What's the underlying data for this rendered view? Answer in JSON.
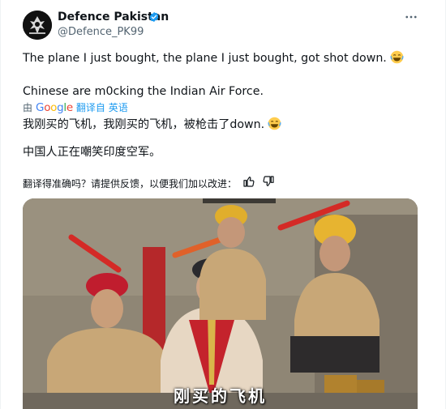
{
  "author": {
    "name": "Defence Pakistan",
    "handle": "@Defence_PK99",
    "verified": true,
    "avatar_icon": "defence-pakistan-logo"
  },
  "post": {
    "line1": "The plane I just bought, the plane I just bought, got shot down.",
    "line2": "Chinese are m0cking the Indian Air Force.",
    "emoji_icon": "laughing-emoji"
  },
  "translation": {
    "prefix": "由",
    "provider": "Google",
    "suffix": "翻译自 英语",
    "zh_line1": "我刚买的飞机，我刚买的飞机，被枪击了down.",
    "zh_line2": "中国人正在嘲笑印度空军。",
    "feedback_prompt": "翻译得准确吗？请提供反馈，以便我们加以改进："
  },
  "media": {
    "caption": "刚买的飞机"
  },
  "colors": {
    "accent": "#1d9bf0",
    "secondary_text": "#536471",
    "text": "#0f1419"
  }
}
